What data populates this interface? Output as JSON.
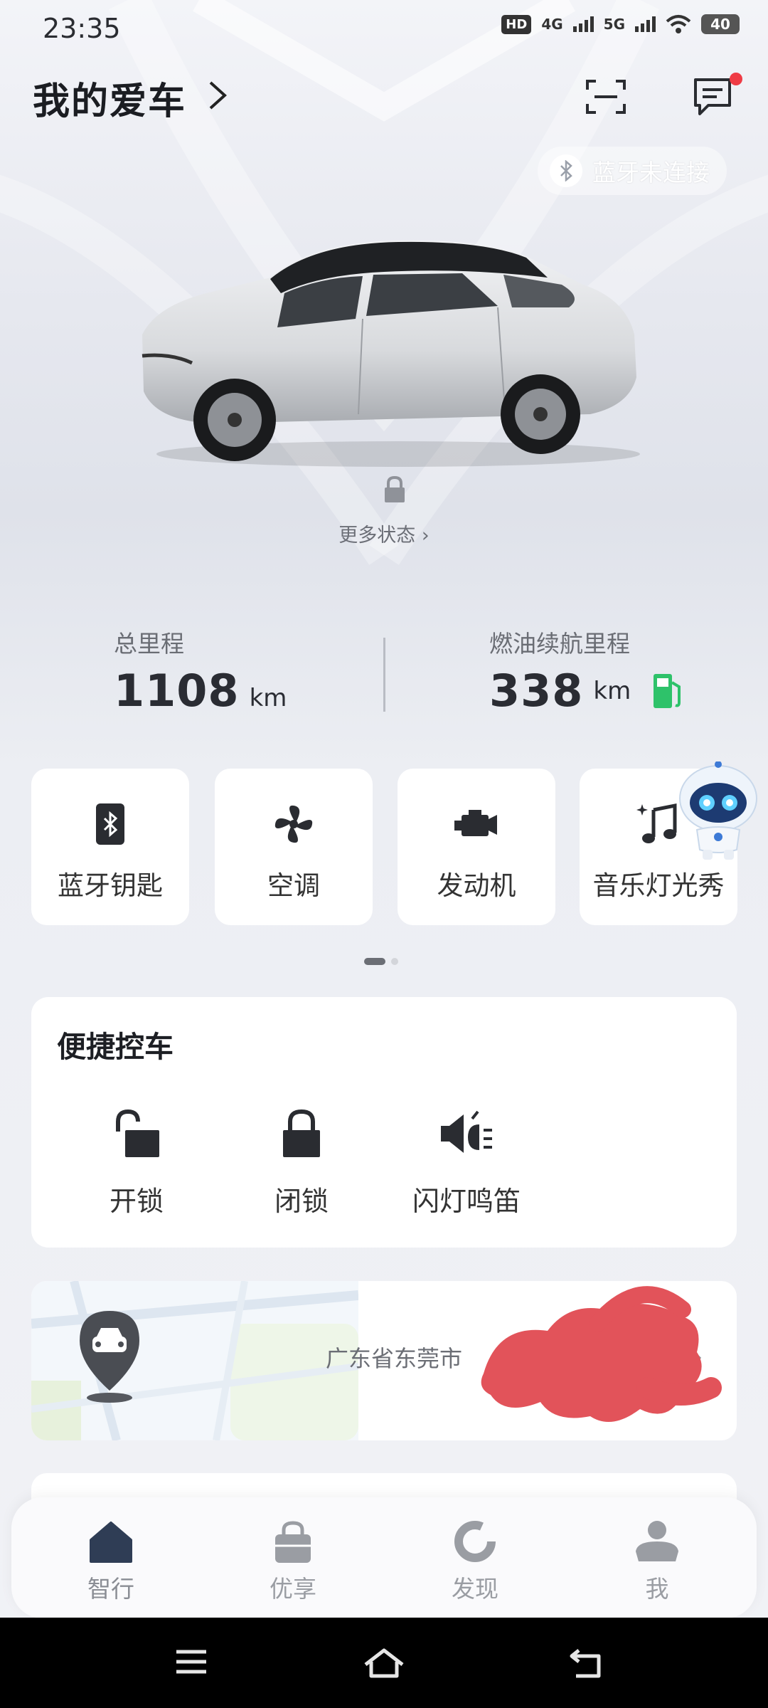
{
  "status_bar": {
    "time": "23:35",
    "hd": "HD",
    "net1": "4G",
    "net2": "5G",
    "battery": "40"
  },
  "header": {
    "title": "我的爱车",
    "bluetooth_status": "蓝牙未连接"
  },
  "car_status": {
    "more_status": "更多状态"
  },
  "stats": {
    "total_mileage_label": "总里程",
    "total_mileage_value": "1108",
    "total_mileage_unit": "km",
    "fuel_range_label": "燃油续航里程",
    "fuel_range_value": "338",
    "fuel_range_unit": "km"
  },
  "functions": [
    {
      "label": "蓝牙钥匙",
      "icon": "bluetooth-key-icon"
    },
    {
      "label": "空调",
      "icon": "fan-icon"
    },
    {
      "label": "发动机",
      "icon": "engine-icon"
    },
    {
      "label": "音乐灯光秀",
      "icon": "music-icon"
    }
  ],
  "quick_control": {
    "title": "便捷控车",
    "items": [
      {
        "label": "开锁",
        "icon": "unlock-icon"
      },
      {
        "label": "闭锁",
        "icon": "lock-icon"
      },
      {
        "label": "闪灯鸣笛",
        "icon": "horn-icon"
      }
    ]
  },
  "location": {
    "address": "广东省东莞市"
  },
  "nav": {
    "items": [
      {
        "label": "智行",
        "icon": "home-icon",
        "active": true
      },
      {
        "label": "优享",
        "icon": "bag-icon",
        "active": false
      },
      {
        "label": "发现",
        "icon": "discover-icon",
        "active": false
      },
      {
        "label": "我",
        "icon": "profile-icon",
        "active": false
      }
    ]
  },
  "colors": {
    "accent": "#2a2c33",
    "fuel_green": "#2ec26a",
    "badge_red": "#ef3b45",
    "scribble": "#e2535a"
  }
}
